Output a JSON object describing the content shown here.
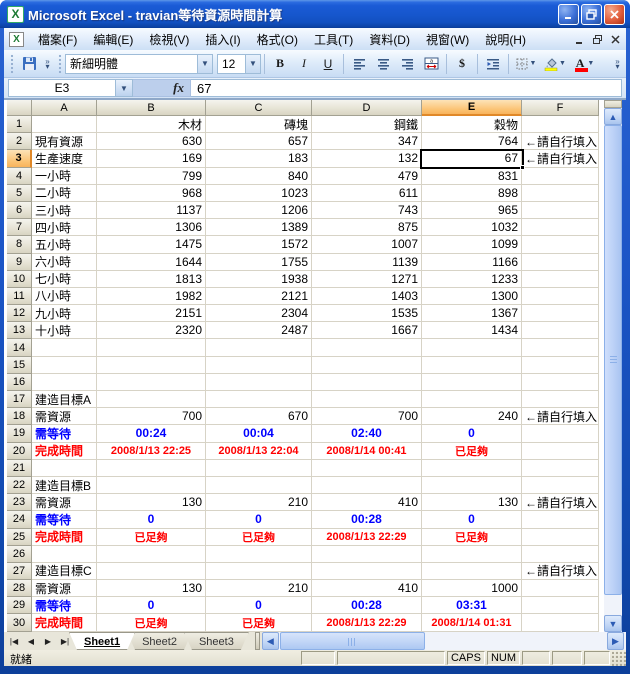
{
  "window": {
    "title": "Microsoft Excel - travian等待資源時間計算",
    "app_icon_letter": "X",
    "doc_icon_letter": "X"
  },
  "menu": {
    "items": [
      "檔案(F)",
      "編輯(E)",
      "檢視(V)",
      "插入(I)",
      "格式(O)",
      "工具(T)",
      "資料(D)",
      "視窗(W)",
      "說明(H)"
    ]
  },
  "toolbar": {
    "font_name": "新細明體",
    "font_size": "12",
    "bold_label": "B",
    "italic_label": "I",
    "underline_label": "U",
    "currency_label": "$",
    "font_color_letter": "A",
    "fill_color_hex": "#ffff00",
    "font_color_hex": "#ff0000"
  },
  "formula_bar": {
    "name_box": "E3",
    "fx_label": "fx",
    "value": "67"
  },
  "grid": {
    "col_headers": [
      "A",
      "B",
      "C",
      "D",
      "E",
      "F"
    ],
    "selected": {
      "col": "E",
      "row": 3,
      "cell": "E3"
    },
    "rows": [
      {
        "n": 1,
        "style": "plain",
        "cells": [
          "",
          "木材",
          "磚塊",
          "鋼鐵",
          "穀物",
          ""
        ]
      },
      {
        "n": 2,
        "style": "plain",
        "cells": [
          "現有資源",
          "630",
          "657",
          "347",
          "764",
          "←請自行填入"
        ]
      },
      {
        "n": 3,
        "style": "plain",
        "cells": [
          "生產速度",
          "169",
          "183",
          "132",
          "67",
          "←請自行填入"
        ]
      },
      {
        "n": 4,
        "style": "plain",
        "cells": [
          "一小時",
          "799",
          "840",
          "479",
          "831",
          ""
        ]
      },
      {
        "n": 5,
        "style": "plain",
        "cells": [
          "二小時",
          "968",
          "1023",
          "611",
          "898",
          ""
        ]
      },
      {
        "n": 6,
        "style": "plain",
        "cells": [
          "三小時",
          "1137",
          "1206",
          "743",
          "965",
          ""
        ]
      },
      {
        "n": 7,
        "style": "plain",
        "cells": [
          "四小時",
          "1306",
          "1389",
          "875",
          "1032",
          ""
        ]
      },
      {
        "n": 8,
        "style": "plain",
        "cells": [
          "五小時",
          "1475",
          "1572",
          "1007",
          "1099",
          ""
        ]
      },
      {
        "n": 9,
        "style": "plain",
        "cells": [
          "六小時",
          "1644",
          "1755",
          "1139",
          "1166",
          ""
        ]
      },
      {
        "n": 10,
        "style": "plain",
        "cells": [
          "七小時",
          "1813",
          "1938",
          "1271",
          "1233",
          ""
        ]
      },
      {
        "n": 11,
        "style": "plain",
        "cells": [
          "八小時",
          "1982",
          "2121",
          "1403",
          "1300",
          ""
        ]
      },
      {
        "n": 12,
        "style": "plain",
        "cells": [
          "九小時",
          "2151",
          "2304",
          "1535",
          "1367",
          ""
        ]
      },
      {
        "n": 13,
        "style": "plain",
        "cells": [
          "十小時",
          "2320",
          "2487",
          "1667",
          "1434",
          ""
        ]
      },
      {
        "n": 14,
        "style": "plain",
        "cells": [
          "",
          "",
          "",
          "",
          "",
          ""
        ]
      },
      {
        "n": 15,
        "style": "plain",
        "cells": [
          "",
          "",
          "",
          "",
          "",
          ""
        ]
      },
      {
        "n": 16,
        "style": "plain",
        "cells": [
          "",
          "",
          "",
          "",
          "",
          ""
        ]
      },
      {
        "n": 17,
        "style": "plain",
        "cells": [
          "建造目標A",
          "",
          "",
          "",
          "",
          ""
        ]
      },
      {
        "n": 18,
        "style": "plain",
        "cells": [
          "需資源",
          "700",
          "670",
          "700",
          "240",
          "←請自行填入"
        ]
      },
      {
        "n": 19,
        "style": "wait",
        "cells": [
          "需等待",
          "00:24",
          "00:04",
          "02:40",
          "0",
          ""
        ]
      },
      {
        "n": 20,
        "style": "done",
        "cells": [
          "完成時間",
          "2008/1/13 22:25",
          "2008/1/13 22:04",
          "2008/1/14 00:41",
          "已足夠",
          ""
        ]
      },
      {
        "n": 21,
        "style": "plain",
        "cells": [
          "",
          "",
          "",
          "",
          "",
          ""
        ]
      },
      {
        "n": 22,
        "style": "plain",
        "cells": [
          "建造目標B",
          "",
          "",
          "",
          "",
          ""
        ]
      },
      {
        "n": 23,
        "style": "plain",
        "cells": [
          "需資源",
          "130",
          "210",
          "410",
          "130",
          "←請自行填入"
        ]
      },
      {
        "n": 24,
        "style": "wait",
        "cells": [
          "需等待",
          "0",
          "0",
          "00:28",
          "0",
          ""
        ]
      },
      {
        "n": 25,
        "style": "done",
        "cells": [
          "完成時間",
          "已足夠",
          "已足夠",
          "2008/1/13 22:29",
          "已足夠",
          ""
        ]
      },
      {
        "n": 26,
        "style": "plain",
        "cells": [
          "",
          "",
          "",
          "",
          "",
          ""
        ]
      },
      {
        "n": 27,
        "style": "plain",
        "cells": [
          "建造目標C",
          "",
          "",
          "",
          "",
          "←請自行填入"
        ]
      },
      {
        "n": 28,
        "style": "plain",
        "cells": [
          "需資源",
          "130",
          "210",
          "410",
          "1000",
          ""
        ]
      },
      {
        "n": 29,
        "style": "wait",
        "cells": [
          "需等待",
          "0",
          "0",
          "00:28",
          "03:31",
          ""
        ]
      },
      {
        "n": 30,
        "style": "done",
        "cells": [
          "完成時間",
          "已足夠",
          "已足夠",
          "2008/1/13 22:29",
          "2008/1/14 01:31",
          ""
        ]
      }
    ],
    "text_colors": {
      "wait": "#0000ff",
      "done": "#ff0000"
    }
  },
  "sheet_tabs": {
    "sheets": [
      "Sheet1",
      "Sheet2",
      "Sheet3"
    ],
    "active": "Sheet1",
    "nav_icons": [
      "|◀",
      "◀",
      "▶",
      "▶|"
    ]
  },
  "status": {
    "message": "就緒",
    "indicators": [
      "CAPS",
      "NUM"
    ]
  },
  "icons": {
    "dropdown_arrow": "▼",
    "scroll_up": "▲",
    "scroll_down": "▼",
    "scroll_left": "◀",
    "scroll_right": "▶",
    "minimize": "_",
    "restore": "❐",
    "close": "×"
  }
}
